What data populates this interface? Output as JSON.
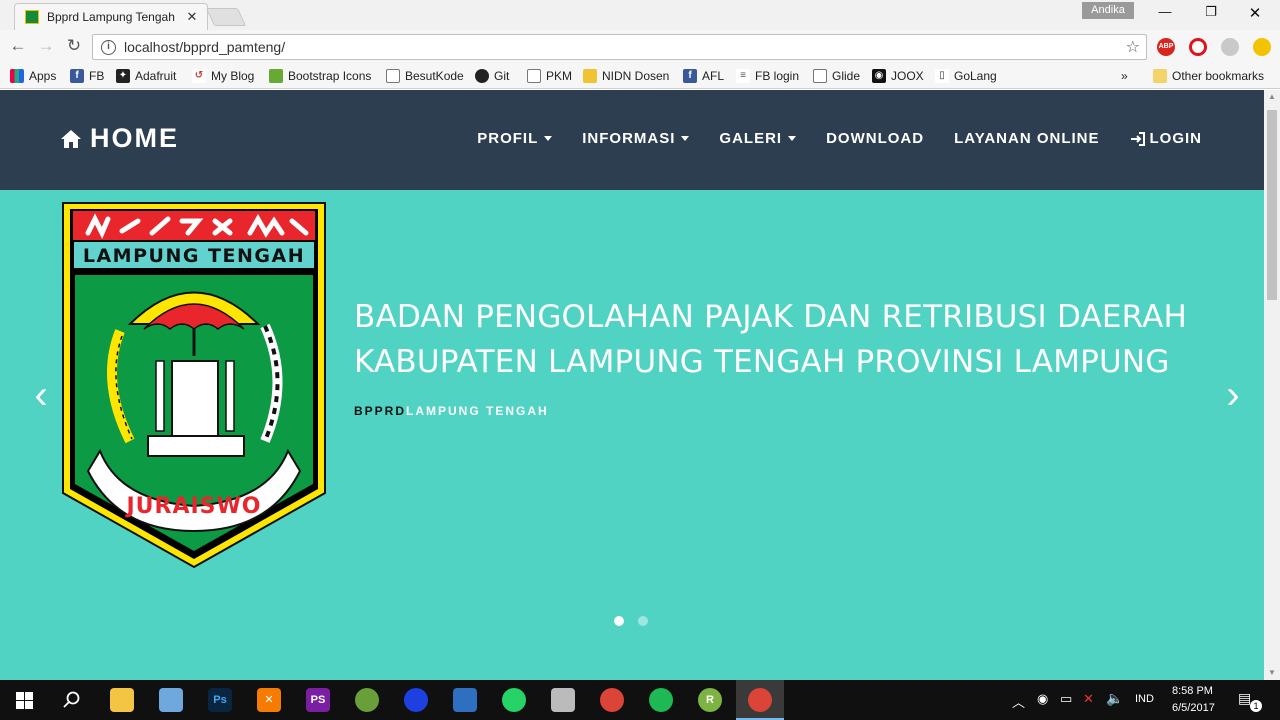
{
  "browser": {
    "tab_title": "Bpprd Lampung Tengah",
    "tab_close": "✕",
    "profile_name": "Andika",
    "url": "localhost/bpprd_pamteng/",
    "extensions": [
      "ABP"
    ]
  },
  "bookmarks": [
    {
      "label": "Apps",
      "icon": "apps-grid-icon"
    },
    {
      "label": "FB",
      "icon": "facebook-icon"
    },
    {
      "label": "Adafruit",
      "icon": "adafruit-icon"
    },
    {
      "label": "My Blog",
      "icon": "blog-icon"
    },
    {
      "label": "Bootstrap Icons",
      "icon": "bootstrap-icon"
    },
    {
      "label": "BesutKode",
      "icon": "page-icon"
    },
    {
      "label": "Git",
      "icon": "git-icon"
    },
    {
      "label": "PKM",
      "icon": "page-icon"
    },
    {
      "label": "NIDN Dosen",
      "icon": "nidn-icon"
    },
    {
      "label": "AFL",
      "icon": "facebook-icon"
    },
    {
      "label": "FB login",
      "icon": "list-icon"
    },
    {
      "label": "Glide",
      "icon": "page-icon"
    },
    {
      "label": "JOOX",
      "icon": "joox-icon"
    },
    {
      "label": "GoLang",
      "icon": "book-icon"
    }
  ],
  "bookmarks_more": "»",
  "other_bookmarks": "Other bookmarks",
  "site": {
    "brand": "HOME",
    "menu": [
      {
        "label": "PROFIL",
        "dropdown": true
      },
      {
        "label": "INFORMASI",
        "dropdown": true
      },
      {
        "label": "GALERI",
        "dropdown": true
      },
      {
        "label": "DOWNLOAD",
        "dropdown": false
      },
      {
        "label": "LAYANAN ONLINE",
        "dropdown": false
      },
      {
        "label": "LOGIN",
        "dropdown": false
      }
    ],
    "logo": {
      "script_text": "ᨊᨕ᨞ᨀ ᨓᨊ",
      "banner": "LAMPUNG TENGAH",
      "motto": "JURAISWO"
    },
    "hero": {
      "title_line1": "BADAN PENGOLAHAN PAJAK DAN RETRIBUSI DAERAH",
      "title_line2": "KABUPATEN LAMPUNG TENGAH PROVINSI LAMPUNG",
      "sub_dark": "BPPRD",
      "sub_light": "LAMPUNG TENGAH",
      "prev": "‹",
      "next": "›",
      "slides": 2,
      "active_slide": 1
    },
    "colors": {
      "nav_bg": "#2c3e50",
      "hero_bg": "#51d3c4"
    }
  },
  "taskbar": {
    "time": "8:58 PM",
    "date": "6/5/2017",
    "language": "IND",
    "notification_count": "1"
  }
}
